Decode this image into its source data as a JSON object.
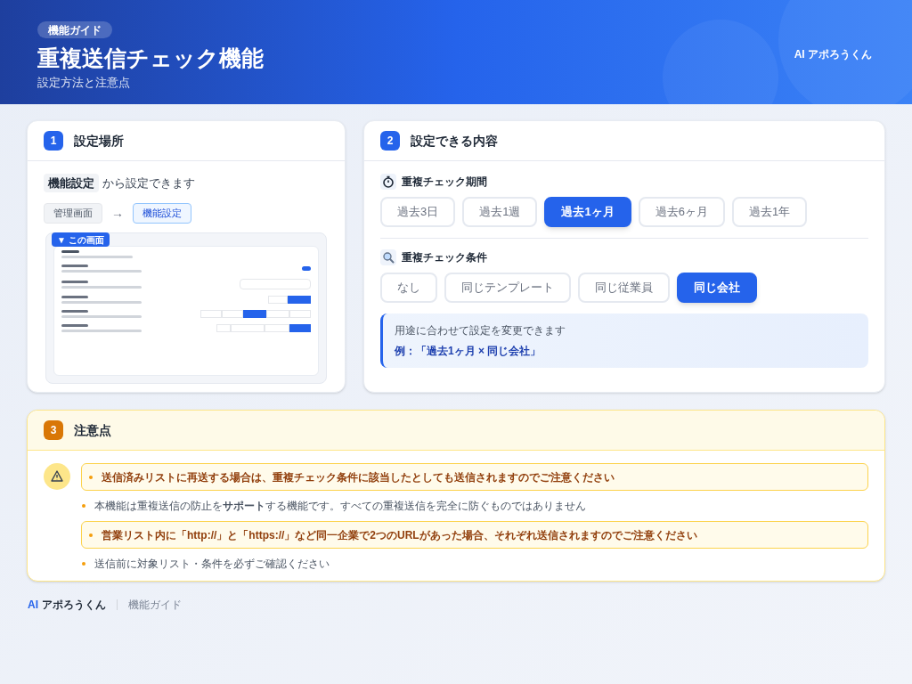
{
  "header": {
    "badge": "機能ガイド",
    "title": "重複送信チェック機能",
    "subtitle": "設定方法と注意点",
    "brand": "AI アポろうくん"
  },
  "location_card": {
    "number": "1",
    "title": "設定場所",
    "lead_emphasis": "機能設定",
    "lead_text": "から設定できます",
    "breadcrumb": [
      {
        "label": "管理画面",
        "current": false
      },
      {
        "label": "機能設定",
        "current": true
      }
    ],
    "breadcrumb_arrow": "→",
    "thumbnail_badge": "▼ この画面"
  },
  "options_card": {
    "number": "2",
    "title": "設定できる内容",
    "groups": [
      {
        "kind": "timer",
        "title": "重複チェック期間",
        "options": [
          {
            "label": "過去3日",
            "selected": false
          },
          {
            "label": "過去1週",
            "selected": false
          },
          {
            "label": "過去1ヶ月",
            "selected": true
          },
          {
            "label": "過去6ヶ月",
            "selected": false
          },
          {
            "label": "過去1年",
            "selected": false
          }
        ]
      },
      {
        "kind": "search",
        "title": "重複チェック条件",
        "options": [
          {
            "label": "なし",
            "selected": false
          },
          {
            "label": "同じテンプレート",
            "selected": false
          },
          {
            "label": "同じ従業員",
            "selected": false
          },
          {
            "label": "同じ会社",
            "selected": true
          }
        ]
      }
    ],
    "note": {
      "text": "用途に合わせて設定を変更できます",
      "example": "例：「過去1ヶ月 × 同じ会社」"
    }
  },
  "notes_card": {
    "number": "3",
    "title": "注意点",
    "items": [
      {
        "text": "**送信済みリストに再送する場合は、重複チェック条件に該当したとしても送信されますのでご注意ください**",
        "highlighted": true
      },
      {
        "text": "本機能は重複送信の防止を**サポート**する機能です。すべての重複送信を完全に防ぐものではありません",
        "highlighted": false
      },
      {
        "text": "**営業リスト内に「http://」と「https://」など同一企業で2つのURLがあった場合、それぞれ送信されますのでご注意ください**",
        "highlighted": true
      },
      {
        "text": "送信前に対象リスト・条件を必ずご確認ください",
        "highlighted": false
      }
    ]
  },
  "footer": {
    "brand_prefix": "AI",
    "brand_name": "アポろうくん",
    "label": "機能ガイド"
  }
}
